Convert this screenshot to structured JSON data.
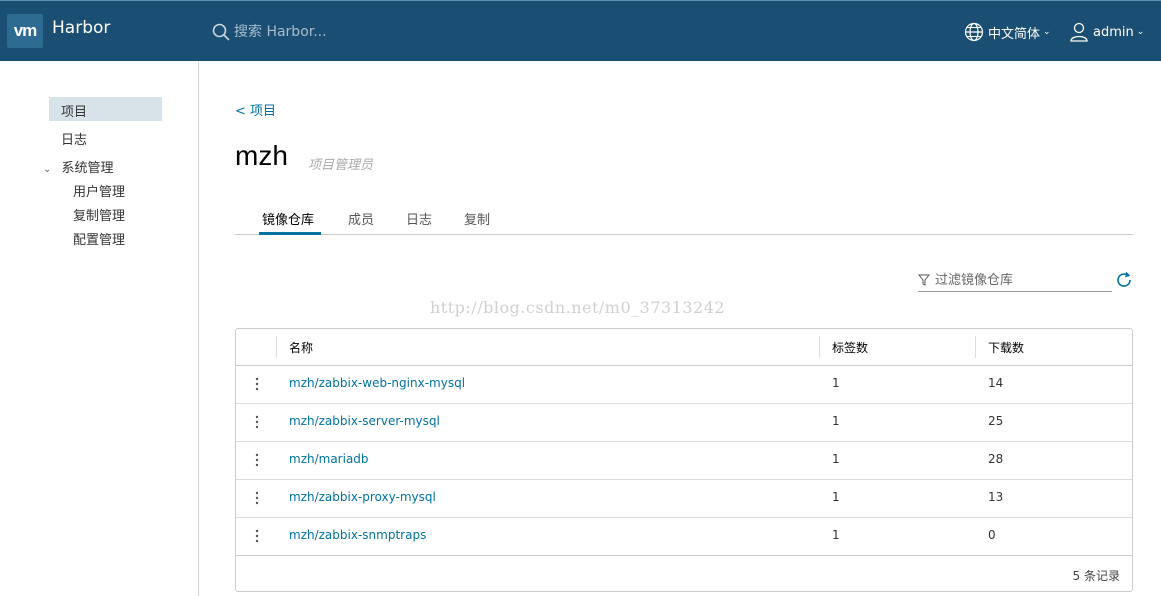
{
  "header": {
    "logo": "vm",
    "brand": "Harbor",
    "search_placeholder": "搜索 Harbor...",
    "language": "中文简体",
    "user": "admin"
  },
  "sidebar": {
    "items": [
      {
        "label": "项目"
      },
      {
        "label": "日志"
      },
      {
        "label": "系统管理"
      },
      {
        "label": "用户管理"
      },
      {
        "label": "复制管理"
      },
      {
        "label": "配置管理"
      }
    ]
  },
  "main": {
    "back_link": "< 项目",
    "project_name": "mzh",
    "project_role": "项目管理员",
    "tabs": [
      {
        "label": "镜像仓库"
      },
      {
        "label": "成员"
      },
      {
        "label": "日志"
      },
      {
        "label": "复制"
      }
    ],
    "filter_placeholder": "过滤镜像仓库",
    "watermark": "http://blog.csdn.net/m0_37313242",
    "columns": [
      "名称",
      "标签数",
      "下载数"
    ],
    "rows": [
      {
        "name": "mzh/zabbix-web-nginx-mysql",
        "tags": "1",
        "pulls": "14"
      },
      {
        "name": "mzh/zabbix-server-mysql",
        "tags": "1",
        "pulls": "25"
      },
      {
        "name": "mzh/mariadb",
        "tags": "1",
        "pulls": "28"
      },
      {
        "name": "mzh/zabbix-proxy-mysql",
        "tags": "1",
        "pulls": "13"
      },
      {
        "name": "mzh/zabbix-snmptraps",
        "tags": "1",
        "pulls": "0"
      }
    ],
    "footer": "5 条记录"
  },
  "colors": {
    "header_bg": "#1a4e73",
    "accent": "#0072a3",
    "nav_active_bg": "#d8e3e9"
  }
}
